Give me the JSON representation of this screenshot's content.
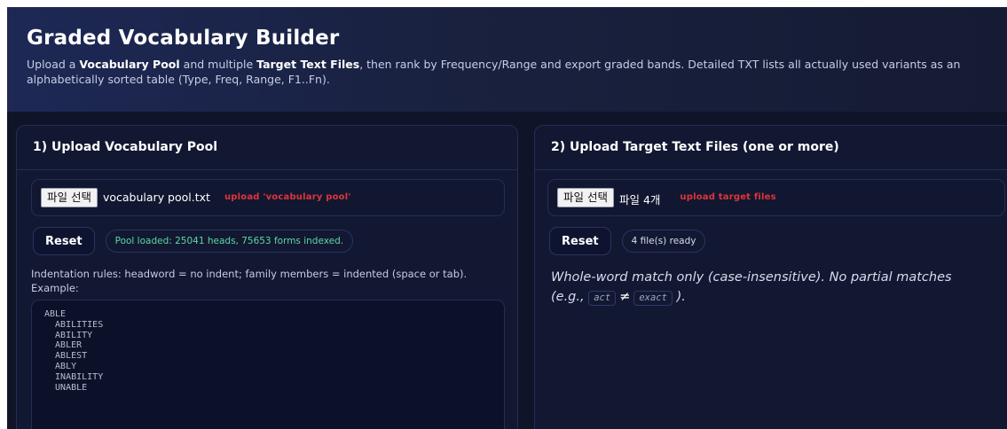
{
  "header": {
    "title": "Graded Vocabulary Builder",
    "subtitle": {
      "p1": "Upload a ",
      "b1": "Vocabulary Pool",
      "p2": " and multiple ",
      "b2": "Target Text Files",
      "p3": ", then rank by Frequency/Range and export graded bands. Detailed TXT lists all actually used variants as an alphabetically sorted table (Type, Freq, Range, F1..Fn)."
    }
  },
  "pool_panel": {
    "title": "1) Upload Vocabulary Pool",
    "file_button": "파일 선택",
    "file_name": "vocabulary pool.txt",
    "hint": "upload 'vocabulary pool'",
    "reset_label": "Reset",
    "status": "Pool loaded: 25041 heads, 75653 forms indexed.",
    "rules_text": "Indentation rules: headword = no indent; family members = indented (space or tab). Example:",
    "example_lines": [
      "ABLE",
      "  ABILITIES",
      "  ABILITY",
      "  ABLER",
      "  ABLEST",
      "  ABLY",
      "  INABILITY",
      "  UNABLE"
    ]
  },
  "target_panel": {
    "title": "2) Upload Target Text Files (one or more)",
    "file_button": "파일 선택",
    "file_name": "파일 4개",
    "hint": "upload target files",
    "reset_label": "Reset",
    "status": "4 file(s) ready",
    "match_note": {
      "text": "Whole-word match only (case-insensitive). No partial matches",
      "eg": "(e.g.,",
      "code1": "act",
      "neq": "≠",
      "code2": "exact",
      "close": ")."
    }
  },
  "colors": {
    "background": "#0f1428",
    "panel": "#121832",
    "hint_red": "#e0343c",
    "status_green": "#5fd6a4"
  }
}
